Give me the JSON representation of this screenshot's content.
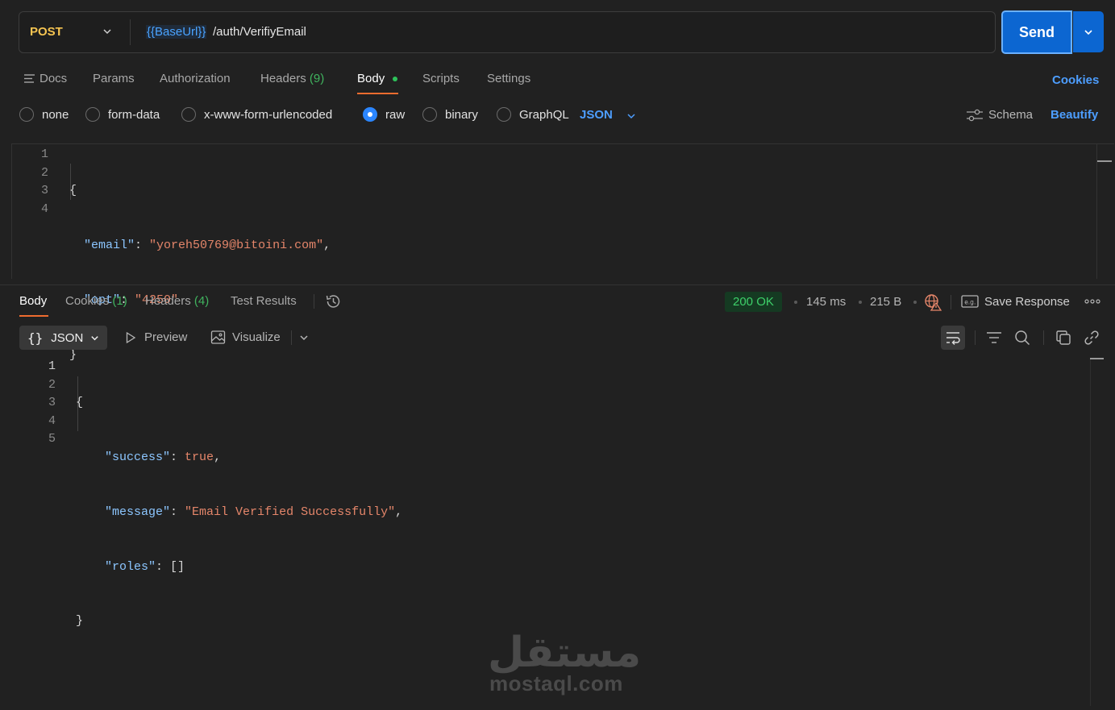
{
  "request": {
    "method": "POST",
    "url_variable": "{{BaseUrl}}",
    "url_path": " /auth/VerifiyEmail",
    "send_label": "Send"
  },
  "request_tabs": {
    "docs": "Docs",
    "params": "Params",
    "authorization": "Authorization",
    "headers": "Headers",
    "headers_count": "(9)",
    "body": "Body",
    "scripts": "Scripts",
    "settings": "Settings",
    "cookies": "Cookies"
  },
  "body_types": {
    "none": "none",
    "form_data": "form-data",
    "urlencoded": "x-www-form-urlencoded",
    "raw": "raw",
    "binary": "binary",
    "graphql": "GraphQL",
    "selected_format": "JSON",
    "schema": "Schema",
    "beautify": "Beautify"
  },
  "request_body": {
    "line_numbers": [
      "1",
      "2",
      "3",
      "4"
    ],
    "open_brace": "{",
    "close_brace": "}",
    "email_key": "\"email\"",
    "email_value": "\"yoreh50769@bitoini.com\"",
    "opt_key": "\"opt\"",
    "opt_value": "\"4250\""
  },
  "response_tabs": {
    "body": "Body",
    "cookies": "Cookies",
    "cookies_count": "(1)",
    "headers": "Headers",
    "headers_count": "(4)",
    "test_results": "Test Results"
  },
  "response_meta": {
    "status": "200 OK",
    "time": "145 ms",
    "size": "215 B",
    "save_response": "Save Response"
  },
  "response_toolbar": {
    "format": "JSON",
    "preview": "Preview",
    "visualize": "Visualize"
  },
  "response_body": {
    "line_numbers": [
      "1",
      "2",
      "3",
      "4",
      "5"
    ],
    "open_brace": "{",
    "close_brace": "}",
    "success_key": "\"success\"",
    "success_value": "true",
    "message_key": "\"message\"",
    "message_value": "\"Email Verified Successfully\"",
    "roles_key": "\"roles\"",
    "roles_value": "[]"
  },
  "watermark": {
    "arabic": "مستقل",
    "latin": "mostaql.com"
  },
  "colors": {
    "background": "#212121",
    "accent_orange": "#ef6c2f",
    "send_blue": "#0c66d1",
    "link_blue": "#4d9eff",
    "method_yellow": "#f5c451",
    "status_green": "#3ed06a"
  }
}
